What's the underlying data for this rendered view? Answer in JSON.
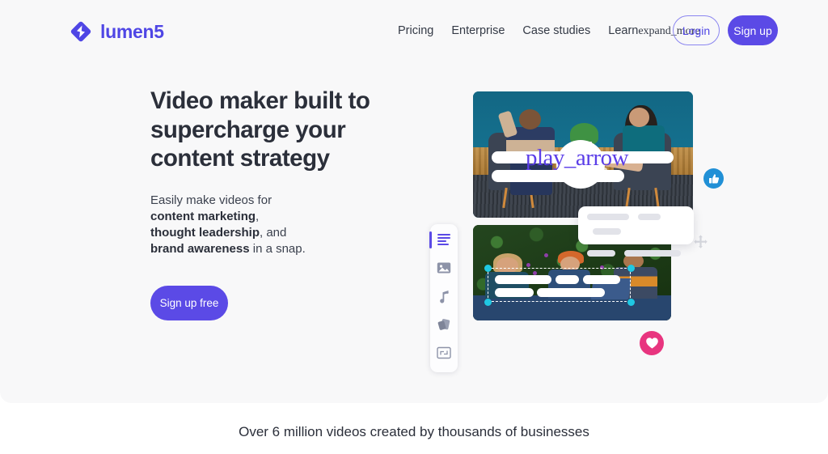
{
  "brand": {
    "name": "lumen5",
    "logo_icon": "lumen5-diamond-logo",
    "color": "#4f46e5"
  },
  "nav": {
    "links": [
      {
        "label": "Pricing",
        "name": "pricing"
      },
      {
        "label": "Enterprise",
        "name": "enterprise"
      },
      {
        "label": "Case studies",
        "name": "case-studies"
      }
    ],
    "learn": {
      "label": "Learn",
      "icon_text": "expand_more"
    },
    "login_label": "Login",
    "signup_label": "Sign up"
  },
  "hero": {
    "headline_line1": "Video maker built to",
    "headline_line2": "supercharge your",
    "headline_line3": "content strategy",
    "sub_line1": "Easily make videos for",
    "sub_bold1": "content marketing",
    "sub_comma1": ",",
    "sub_bold2": "thought leadership",
    "sub_mid2": ", and",
    "sub_bold3": "brand awareness",
    "sub_tail3": " in a snap.",
    "cta_label": "Sign up free"
  },
  "mock": {
    "play_icon_text": "play_arrow",
    "rail_items": [
      {
        "name": "text-tool",
        "icon": "text-lines-icon",
        "active": true
      },
      {
        "name": "image-tool",
        "icon": "image-icon",
        "active": false
      },
      {
        "name": "music-tool",
        "icon": "music-note-icon",
        "active": false
      },
      {
        "name": "layers-tool",
        "icon": "layers-icon",
        "active": false
      },
      {
        "name": "resize-tool",
        "icon": "expand-frame-icon",
        "active": false
      }
    ],
    "badges": [
      {
        "name": "thumbs-up-badge",
        "icon": "thumbs-up-icon",
        "color": "#2190d6"
      },
      {
        "name": "heart-badge",
        "icon": "heart-icon",
        "color": "#e8357f"
      }
    ],
    "move_icon": "move-cross-icon"
  },
  "social_proof": "Over 6 million videos created by thousands of businesses",
  "colors": {
    "accent": "#5b4ae6",
    "bg": "#f8f8f9",
    "text": "#2b2f3a",
    "handle": "#1fc8e3"
  }
}
